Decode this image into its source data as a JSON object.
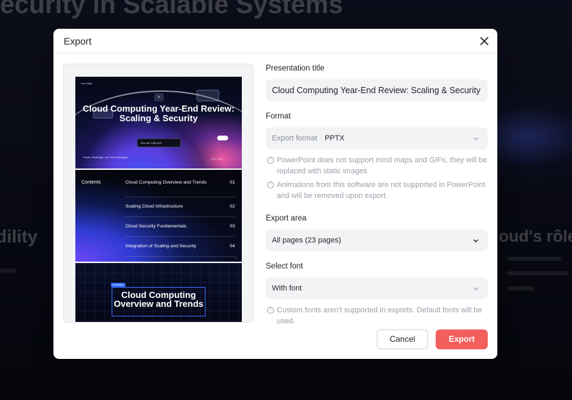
{
  "background": {
    "title": "ecurity in Scalable Systems",
    "left_text": "dility",
    "right_text": "oud's rôle"
  },
  "dialog": {
    "title": "Export",
    "close_icon": "close-icon",
    "preview": {
      "slide1": {
        "logo": "Your logo",
        "chip": "≡",
        "title": "Cloud Computing Year-End Review: Scaling & Security",
        "input_text": "How can I help you?",
        "subtitle": "Trends, Challenges, and Future Strategies",
        "footer": "2024 | 12/31"
      },
      "slide2": {
        "heading": "Contents",
        "items": [
          {
            "label": "Cloud Computing Overview and Trends",
            "num": "01"
          },
          {
            "label": "Scaling Cloud Infrastructure",
            "num": "02"
          },
          {
            "label": "Cloud Security Fundamentals",
            "num": "03"
          },
          {
            "label": "Integration of Scaling and Security",
            "num": "04"
          }
        ],
        "page_number": "2"
      },
      "slide3": {
        "tag": "01 Section",
        "title": "Cloud Computing Overview and Trends"
      }
    },
    "form": {
      "presentation_title_label": "Presentation title",
      "presentation_title_value": "Cloud Computing Year-End Review: Scaling & Security",
      "format_label": "Format",
      "export_format_prefix": "Export format",
      "export_format_value": "PPTX",
      "hint_mindmaps": "PowerPoint does not support mind maps and GIFs, they will be replaced with static images",
      "hint_animations": "Animations from this software are not supported in PowerPoint and will be removed upon export.",
      "export_area_label": "Export area",
      "export_area_value": "All pages (23 pages)",
      "select_font_label": "Select font",
      "select_font_value": "With font",
      "hint_fonts": "Custom fonts aren’t supported in exports. Default fonts will be used."
    },
    "buttons": {
      "cancel": "Cancel",
      "export": "Export"
    }
  },
  "colors": {
    "accent": "#f25f5c",
    "field_bg": "#f2f3f5",
    "hint": "#9aa0aa"
  }
}
